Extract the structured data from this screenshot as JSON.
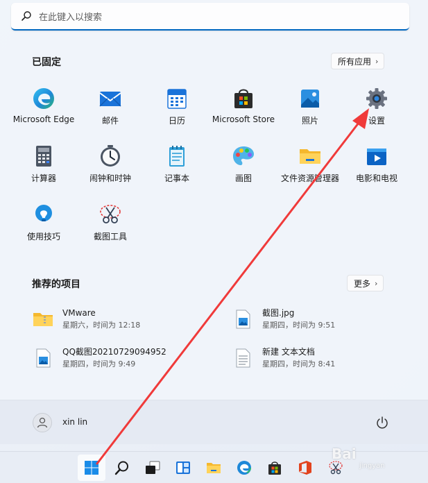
{
  "search": {
    "placeholder": "在此键入以搜索"
  },
  "pinned": {
    "title": "已固定",
    "all_apps_label": "所有应用",
    "apps": [
      {
        "label": "Microsoft Edge",
        "icon": "edge-icon"
      },
      {
        "label": "邮件",
        "icon": "mail-icon"
      },
      {
        "label": "日历",
        "icon": "calendar-icon"
      },
      {
        "label": "Microsoft Store",
        "icon": "store-icon"
      },
      {
        "label": "照片",
        "icon": "photos-icon"
      },
      {
        "label": "设置",
        "icon": "gear-icon"
      },
      {
        "label": "计算器",
        "icon": "calculator-icon"
      },
      {
        "label": "闹钟和时钟",
        "icon": "clock-icon"
      },
      {
        "label": "记事本",
        "icon": "notepad-icon"
      },
      {
        "label": "画图",
        "icon": "paint-icon"
      },
      {
        "label": "文件资源管理器",
        "icon": "folder-icon"
      },
      {
        "label": "电影和电视",
        "icon": "movies-icon"
      },
      {
        "label": "使用技巧",
        "icon": "tips-icon"
      },
      {
        "label": "截图工具",
        "icon": "snipping-tool-icon"
      }
    ]
  },
  "recommended": {
    "title": "推荐的项目",
    "more_label": "更多",
    "items": [
      {
        "name": "VMware",
        "time": "星期六，时间为 12:18",
        "icon": "zip-folder-icon"
      },
      {
        "name": "截图.jpg",
        "time": "星期四，时间为 9:51",
        "icon": "image-file-icon"
      },
      {
        "name": "QQ截图20210729094952",
        "time": "星期四，时间为 9:49",
        "icon": "image-file-icon"
      },
      {
        "name": "新建 文本文档",
        "time": "星期四，时间为 8:41",
        "icon": "text-file-icon"
      }
    ]
  },
  "user": {
    "name": "xin lin"
  },
  "watermark": {
    "text": "Bai",
    "sub": "jingyan"
  },
  "colors": {
    "accent": "#0067c0",
    "arrow": "#f03a3a"
  }
}
